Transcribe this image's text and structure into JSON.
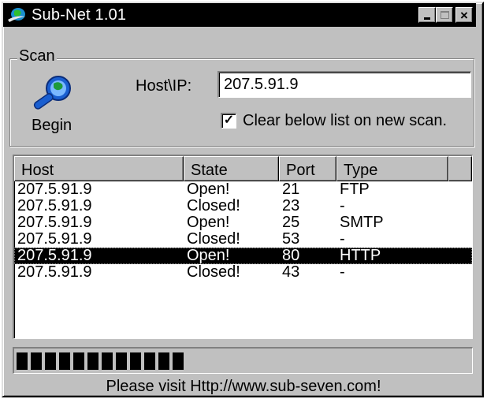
{
  "window": {
    "title": "Sub-Net 1.01",
    "buttons": {
      "minimize": "_",
      "maximize": "□",
      "close": "×"
    }
  },
  "scan": {
    "legend": "Scan",
    "begin_label": "Begin",
    "host_label": "Host\\IP:",
    "host_value": "207.5.91.9",
    "clear_checked": true,
    "clear_label": "Clear below list on new scan."
  },
  "list": {
    "columns": [
      "Host",
      "State",
      "Port",
      "Type"
    ],
    "rows": [
      {
        "host": "207.5.91.9",
        "state": "Open!",
        "port": "21",
        "type": "FTP"
      },
      {
        "host": "207.5.91.9",
        "state": "Closed!",
        "port": "23",
        "type": "-"
      },
      {
        "host": "207.5.91.9",
        "state": "Open!",
        "port": "25",
        "type": "SMTP"
      },
      {
        "host": "207.5.91.9",
        "state": "Closed!",
        "port": "53",
        "type": "-"
      },
      {
        "host": "207.5.91.9",
        "state": "Open!",
        "port": "80",
        "type": "HTTP"
      },
      {
        "host": "207.5.91.9",
        "state": "Closed!",
        "port": "43",
        "type": "-"
      }
    ],
    "selected_row": 4
  },
  "progress": {
    "blocks": 12,
    "fraction": 0.37
  },
  "footer": {
    "text": "Please visit Http://www.sub-seven.com!"
  },
  "colors": {
    "face": "#c0c0c0",
    "titlebar": "#000000",
    "selection": "#000000",
    "icon_blue": "#1a5fd0"
  },
  "icons": {
    "app": "globe-icon",
    "begin": "globe-magnifier-icon",
    "check": "checkmark-icon"
  }
}
